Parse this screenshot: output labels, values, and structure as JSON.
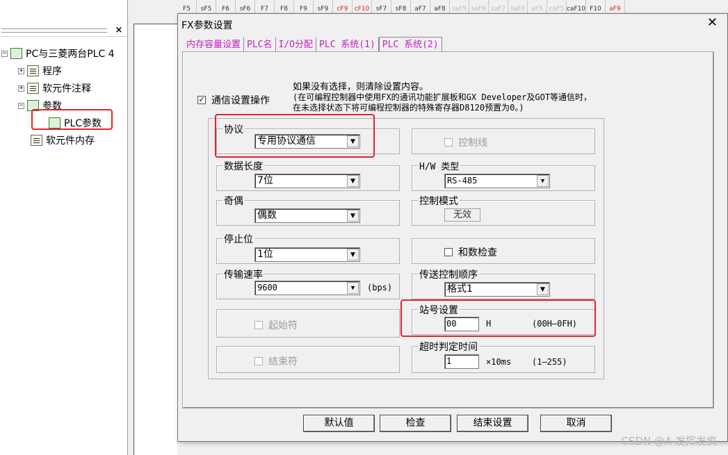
{
  "toolbar": {
    "buttons": [
      {
        "label": "F5",
        "state": "normal"
      },
      {
        "label": "sF5",
        "state": "normal"
      },
      {
        "label": "F6",
        "state": "normal"
      },
      {
        "label": "sF6",
        "state": "normal"
      },
      {
        "label": "F7",
        "state": "normal"
      },
      {
        "label": "F8",
        "state": "normal"
      },
      {
        "label": "F9",
        "state": "normal"
      },
      {
        "label": "sF9",
        "state": "normal"
      },
      {
        "label": "cF9",
        "state": "red"
      },
      {
        "label": "cF10",
        "state": "red"
      },
      {
        "label": "sF7",
        "state": "normal"
      },
      {
        "label": "sF8",
        "state": "normal"
      },
      {
        "label": "aF7",
        "state": "normal"
      },
      {
        "label": "aF8",
        "state": "normal"
      },
      {
        "label": "saF5",
        "state": "dis"
      },
      {
        "label": "saF6",
        "state": "dis"
      },
      {
        "label": "saF7",
        "state": "dis"
      },
      {
        "label": "saF8",
        "state": "dis"
      },
      {
        "label": "aF5",
        "state": "dis"
      },
      {
        "label": "caF5",
        "state": "dis"
      },
      {
        "label": "caF10",
        "state": "normal"
      },
      {
        "label": "F10",
        "state": "normal"
      },
      {
        "label": "aF9",
        "state": "red"
      }
    ]
  },
  "tree": {
    "root": "PC与三菱两台PLC 4",
    "items": [
      "程序",
      "软元件注释",
      "参数",
      "PLC参数",
      "软元件内存"
    ]
  },
  "dialog": {
    "title": "FX参数设置",
    "close": "✕",
    "tabs": [
      "内存容量设置",
      "PLC名",
      "I/O分配",
      "PLC 系统(1)",
      "PLC 系统(2)"
    ],
    "active_tab": 4,
    "note_line1": "如果没有选择，则清除设置内容。",
    "note_line2": "(在可编程控制器中使用FX的通讯功能扩展板和GX Developer及GOT等通信时，",
    "note_line3": "在未选择状态下将可编程控制器的特殊寄存器D8120预置为0。)",
    "comm_checkbox": {
      "label": "通信设置操作",
      "checked": true
    },
    "protocol": {
      "label": "协议",
      "value": "专用协议通信"
    },
    "data_length": {
      "label": "数据长度",
      "value": "7位"
    },
    "parity": {
      "label": "奇偶",
      "value": "偶数"
    },
    "stop_bit": {
      "label": "停止位",
      "value": "1位"
    },
    "baud": {
      "label": "传输速率",
      "value": "9600",
      "unit": "(bps)"
    },
    "start_char": {
      "label": "起始符",
      "checked": false
    },
    "end_char": {
      "label": "结束符",
      "checked": false
    },
    "control_line": {
      "label": "控制线",
      "checked": false
    },
    "hw_type": {
      "label": "H/W 类型",
      "value": "RS-485"
    },
    "control_mode": {
      "label": "控制模式",
      "value": "无效"
    },
    "sum_check": {
      "label": "和数检查",
      "checked": false
    },
    "transfer_seq": {
      "label": "传送控制顺序",
      "value": "格式1"
    },
    "station": {
      "label": "站号设置",
      "value": "00",
      "suffix": "H",
      "range": "(00H—0FH)"
    },
    "timeout": {
      "label": "超时判定时间",
      "value": "1",
      "suffix": "×10ms",
      "range": "(1—255)"
    },
    "buttons": {
      "default": "默认值",
      "check": "检查",
      "finish": "结束设置",
      "cancel": "取消"
    },
    "checkmark": "✓",
    "dropdown_arrow": "▼"
  },
  "watermark": "CSDN @A  发挥发疯",
  "colors": {
    "tab_text": "#c020c0",
    "highlight": "#e0242a"
  }
}
